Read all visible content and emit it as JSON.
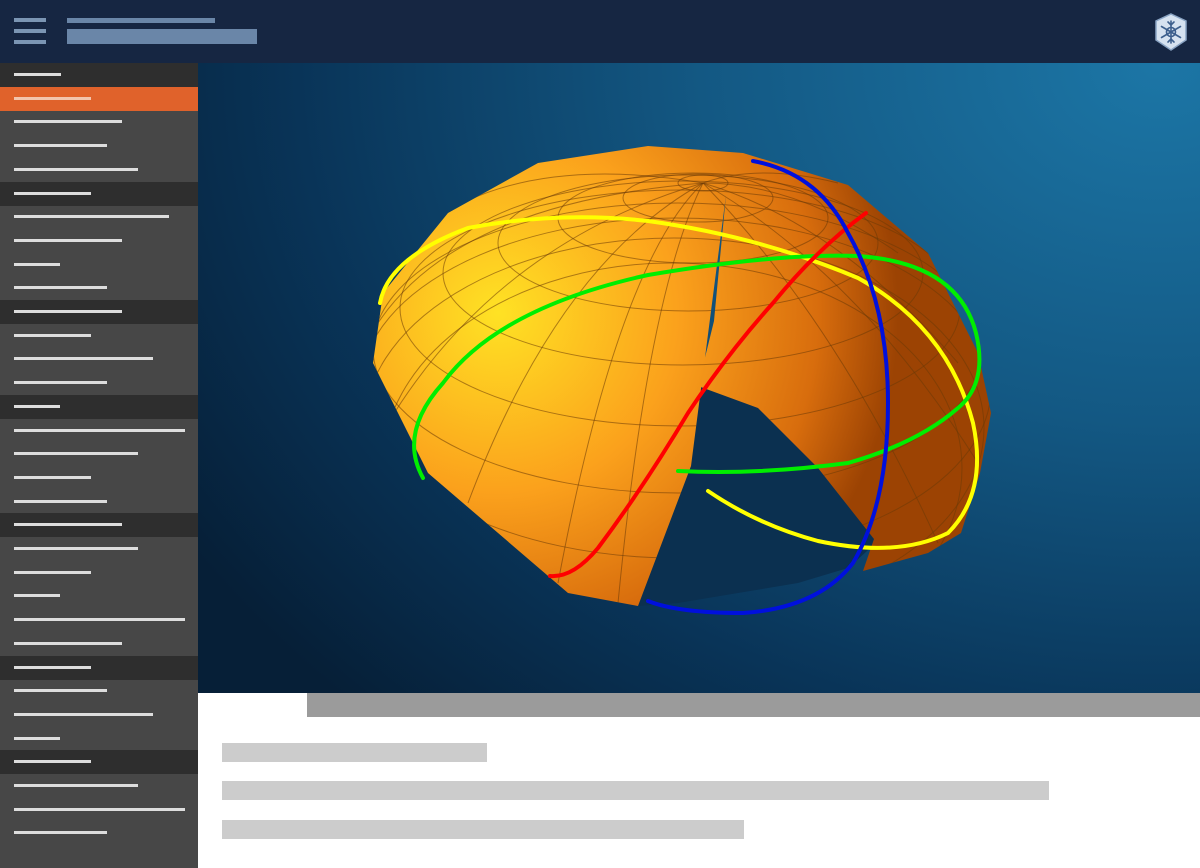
{
  "header": {
    "menu_icon": "hamburger-menu-icon",
    "logo_icon": "snowflake-logo-icon",
    "colors": {
      "bg": "#162642",
      "accent": "#6a86a8"
    }
  },
  "sidebar": {
    "colors": {
      "bg": "#474747",
      "section": "#2e2e2e",
      "active": "#e0622b"
    },
    "rows": [
      {
        "kind": "section"
      },
      {
        "kind": "item",
        "active": true
      },
      {
        "kind": "item"
      },
      {
        "kind": "item"
      },
      {
        "kind": "item"
      },
      {
        "kind": "section"
      },
      {
        "kind": "item"
      },
      {
        "kind": "item"
      },
      {
        "kind": "item"
      },
      {
        "kind": "item"
      },
      {
        "kind": "section"
      },
      {
        "kind": "item"
      },
      {
        "kind": "item"
      },
      {
        "kind": "item"
      },
      {
        "kind": "section"
      },
      {
        "kind": "item"
      },
      {
        "kind": "item"
      },
      {
        "kind": "item"
      },
      {
        "kind": "item"
      },
      {
        "kind": "section"
      },
      {
        "kind": "item"
      },
      {
        "kind": "item"
      },
      {
        "kind": "item"
      },
      {
        "kind": "item"
      },
      {
        "kind": "item"
      },
      {
        "kind": "section"
      },
      {
        "kind": "item"
      },
      {
        "kind": "item"
      },
      {
        "kind": "item"
      },
      {
        "kind": "section"
      },
      {
        "kind": "item"
      },
      {
        "kind": "item"
      },
      {
        "kind": "item"
      }
    ]
  },
  "viewport": {
    "object": "spherical-coordinates-surface",
    "colors": {
      "surface": "#f59a1c",
      "curve_yellow": "#ffff00",
      "curve_green": "#00ee00",
      "curve_red": "#ff0000",
      "curve_blue": "#0010dd"
    }
  },
  "content": {
    "colors": {
      "header_bar": "#9b9b9b",
      "text_placeholder": "#cccccc"
    }
  }
}
